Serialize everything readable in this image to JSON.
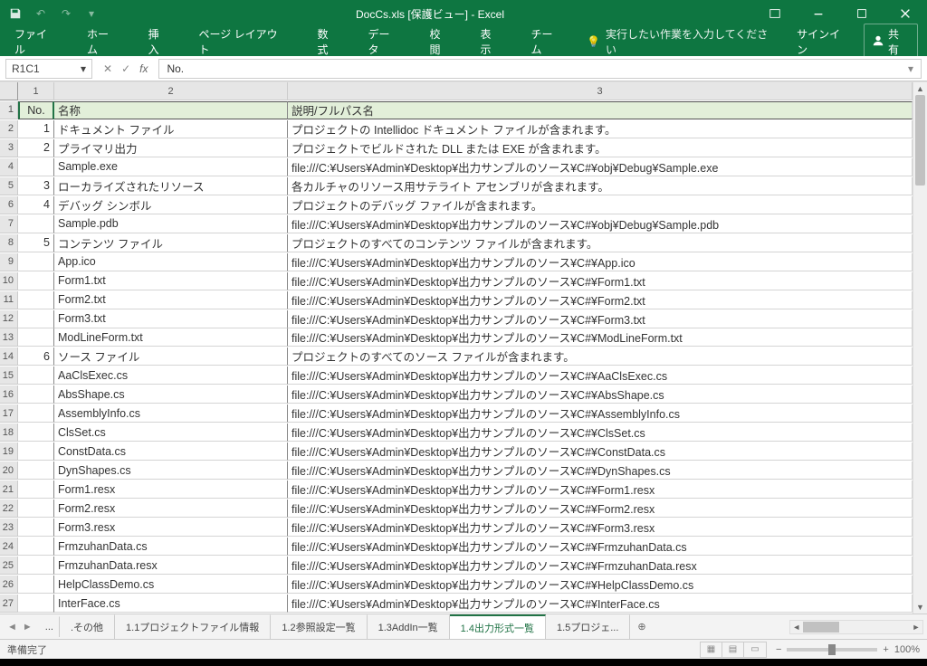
{
  "title": "DocCs.xls [保護ビュー] - Excel",
  "qat": {
    "undo": "↶",
    "redo": "↷",
    "dropdown": "▾"
  },
  "ribbon": {
    "tabs": [
      "ファイル",
      "ホーム",
      "挿入",
      "ページ レイアウト",
      "数式",
      "データ",
      "校閲",
      "表示",
      "チーム"
    ],
    "tellme_icon": "💡",
    "tellme": "実行したい作業を入力してください",
    "signin": "サインイン",
    "share": "共有"
  },
  "formula": {
    "namebox": "R1C1",
    "fx": "fx",
    "value": "No."
  },
  "colhdrs": [
    "1",
    "2",
    "3"
  ],
  "header_row": [
    "No.",
    "名称",
    "説明/フルパス名"
  ],
  "rows": [
    {
      "n": "1",
      "no": "1",
      "name": "ドキュメント ファイル",
      "desc": "プロジェクトの Intellidoc ドキュメント ファイルが含まれます。"
    },
    {
      "n": "2",
      "no": "2",
      "name": "プライマリ出力",
      "desc": "プロジェクトでビルドされた DLL または EXE が含まれます。"
    },
    {
      "n": "3",
      "no": "",
      "name": "Sample.exe",
      "desc": "file:///C:¥Users¥Admin¥Desktop¥出力サンプルのソース¥C#¥obj¥Debug¥Sample.exe"
    },
    {
      "n": "4",
      "no": "3",
      "name": "ローカライズされたリソース",
      "desc": "各カルチャのリソース用サテライト アセンブリが含まれます。"
    },
    {
      "n": "5",
      "no": "4",
      "name": "デバッグ シンボル",
      "desc": "プロジェクトのデバッグ ファイルが含まれます。"
    },
    {
      "n": "6",
      "no": "",
      "name": "Sample.pdb",
      "desc": "file:///C:¥Users¥Admin¥Desktop¥出力サンプルのソース¥C#¥obj¥Debug¥Sample.pdb"
    },
    {
      "n": "7",
      "no": "5",
      "name": "コンテンツ ファイル",
      "desc": "プロジェクトのすべてのコンテンツ ファイルが含まれます。"
    },
    {
      "n": "8",
      "no": "",
      "name": "App.ico",
      "desc": "file:///C:¥Users¥Admin¥Desktop¥出力サンプルのソース¥C#¥App.ico"
    },
    {
      "n": "9",
      "no": "",
      "name": "Form1.txt",
      "desc": "file:///C:¥Users¥Admin¥Desktop¥出力サンプルのソース¥C#¥Form1.txt"
    },
    {
      "n": "10",
      "no": "",
      "name": "Form2.txt",
      "desc": "file:///C:¥Users¥Admin¥Desktop¥出力サンプルのソース¥C#¥Form2.txt"
    },
    {
      "n": "11",
      "no": "",
      "name": "Form3.txt",
      "desc": "file:///C:¥Users¥Admin¥Desktop¥出力サンプルのソース¥C#¥Form3.txt"
    },
    {
      "n": "12",
      "no": "",
      "name": "ModLineForm.txt",
      "desc": "file:///C:¥Users¥Admin¥Desktop¥出力サンプルのソース¥C#¥ModLineForm.txt"
    },
    {
      "n": "13",
      "no": "6",
      "name": "ソース ファイル",
      "desc": "プロジェクトのすべてのソース ファイルが含まれます。"
    },
    {
      "n": "14",
      "no": "",
      "name": "AaClsExec.cs",
      "desc": "file:///C:¥Users¥Admin¥Desktop¥出力サンプルのソース¥C#¥AaClsExec.cs"
    },
    {
      "n": "15",
      "no": "",
      "name": "AbsShape.cs",
      "desc": "file:///C:¥Users¥Admin¥Desktop¥出力サンプルのソース¥C#¥AbsShape.cs"
    },
    {
      "n": "16",
      "no": "",
      "name": "AssemblyInfo.cs",
      "desc": "file:///C:¥Users¥Admin¥Desktop¥出力サンプルのソース¥C#¥AssemblyInfo.cs"
    },
    {
      "n": "17",
      "no": "",
      "name": "ClsSet.cs",
      "desc": "file:///C:¥Users¥Admin¥Desktop¥出力サンプルのソース¥C#¥ClsSet.cs"
    },
    {
      "n": "18",
      "no": "",
      "name": "ConstData.cs",
      "desc": "file:///C:¥Users¥Admin¥Desktop¥出力サンプルのソース¥C#¥ConstData.cs"
    },
    {
      "n": "19",
      "no": "",
      "name": "DynShapes.cs",
      "desc": "file:///C:¥Users¥Admin¥Desktop¥出力サンプルのソース¥C#¥DynShapes.cs"
    },
    {
      "n": "20",
      "no": "",
      "name": "Form1.resx",
      "desc": "file:///C:¥Users¥Admin¥Desktop¥出力サンプルのソース¥C#¥Form1.resx"
    },
    {
      "n": "21",
      "no": "",
      "name": "Form2.resx",
      "desc": "file:///C:¥Users¥Admin¥Desktop¥出力サンプルのソース¥C#¥Form2.resx"
    },
    {
      "n": "22",
      "no": "",
      "name": "Form3.resx",
      "desc": "file:///C:¥Users¥Admin¥Desktop¥出力サンプルのソース¥C#¥Form3.resx"
    },
    {
      "n": "23",
      "no": "",
      "name": "FrmzuhanData.cs",
      "desc": "file:///C:¥Users¥Admin¥Desktop¥出力サンプルのソース¥C#¥FrmzuhanData.cs"
    },
    {
      "n": "24",
      "no": "",
      "name": "FrmzuhanData.resx",
      "desc": "file:///C:¥Users¥Admin¥Desktop¥出力サンプルのソース¥C#¥FrmzuhanData.resx"
    },
    {
      "n": "25",
      "no": "",
      "name": "HelpClassDemo.cs",
      "desc": "file:///C:¥Users¥Admin¥Desktop¥出力サンプルのソース¥C#¥HelpClassDemo.cs"
    },
    {
      "n": "26",
      "no": "",
      "name": "InterFace.cs",
      "desc": "file:///C:¥Users¥Admin¥Desktop¥出力サンプルのソース¥C#¥InterFace.cs"
    }
  ],
  "sheets": {
    "ellipsis": "...",
    "tabs": [
      ".その他",
      "1.1プロジェクトファイル情報",
      "1.2参照設定一覧",
      "1.3AddIn一覧",
      "1.4出力形式一覧",
      "1.5プロジェ..."
    ],
    "active": 4
  },
  "status": {
    "left": "準備完了",
    "zoom": "100%"
  }
}
